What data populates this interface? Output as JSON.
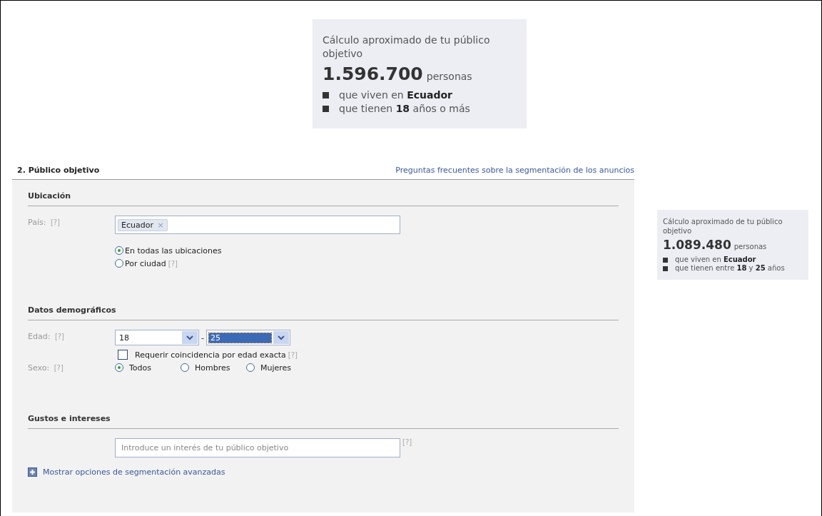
{
  "estimate_top": {
    "title": "Cálculo aproximado de tu público objetivo",
    "count": "1.596.700",
    "unit": "personas",
    "bullets": [
      "que viven en **Ecuador**",
      "que tienen **18** años o más"
    ]
  },
  "section": {
    "title": "2. Público objetivo",
    "faq_link": "Preguntas frecuentes sobre la segmentación de los anuncios"
  },
  "location": {
    "heading": "Ubicación",
    "country_label": "País:",
    "country_help": "[?]",
    "tokens": [
      {
        "label": "Ecuador",
        "remove": "×"
      }
    ],
    "options": [
      {
        "label": "En todas las ubicaciones",
        "selected": true
      },
      {
        "label": "Por ciudad",
        "selected": false,
        "help": "[?]"
      }
    ]
  },
  "demographics": {
    "heading": "Datos demográficos",
    "age_label": "Edad:",
    "age_help": "[?]",
    "age_from": {
      "value": "18",
      "highlighted": false
    },
    "separator": "-",
    "age_to": {
      "value": "25",
      "highlighted": true
    },
    "exact_match": {
      "label": "Requerir coincidencia por edad exacta",
      "checked": false,
      "help": "[?]"
    },
    "sex_label": "Sexo:",
    "sex_help": "[?]",
    "sex_options": [
      {
        "label": "Todos",
        "selected": true
      },
      {
        "label": "Hombres",
        "selected": false
      },
      {
        "label": "Mujeres",
        "selected": false
      }
    ]
  },
  "interests": {
    "heading": "Gustos e intereses",
    "placeholder": "Introduce un interés de tu público objetivo",
    "help": "[?]"
  },
  "advanced_link": "Mostrar opciones de segmentación avanzadas",
  "estimate_side": {
    "title": "Cálculo aproximado de tu público objetivo",
    "count": "1.089.480",
    "unit": "personas",
    "bullets": [
      "que viven en **Ecuador**",
      "que tienen entre **18** y **25** años"
    ]
  }
}
